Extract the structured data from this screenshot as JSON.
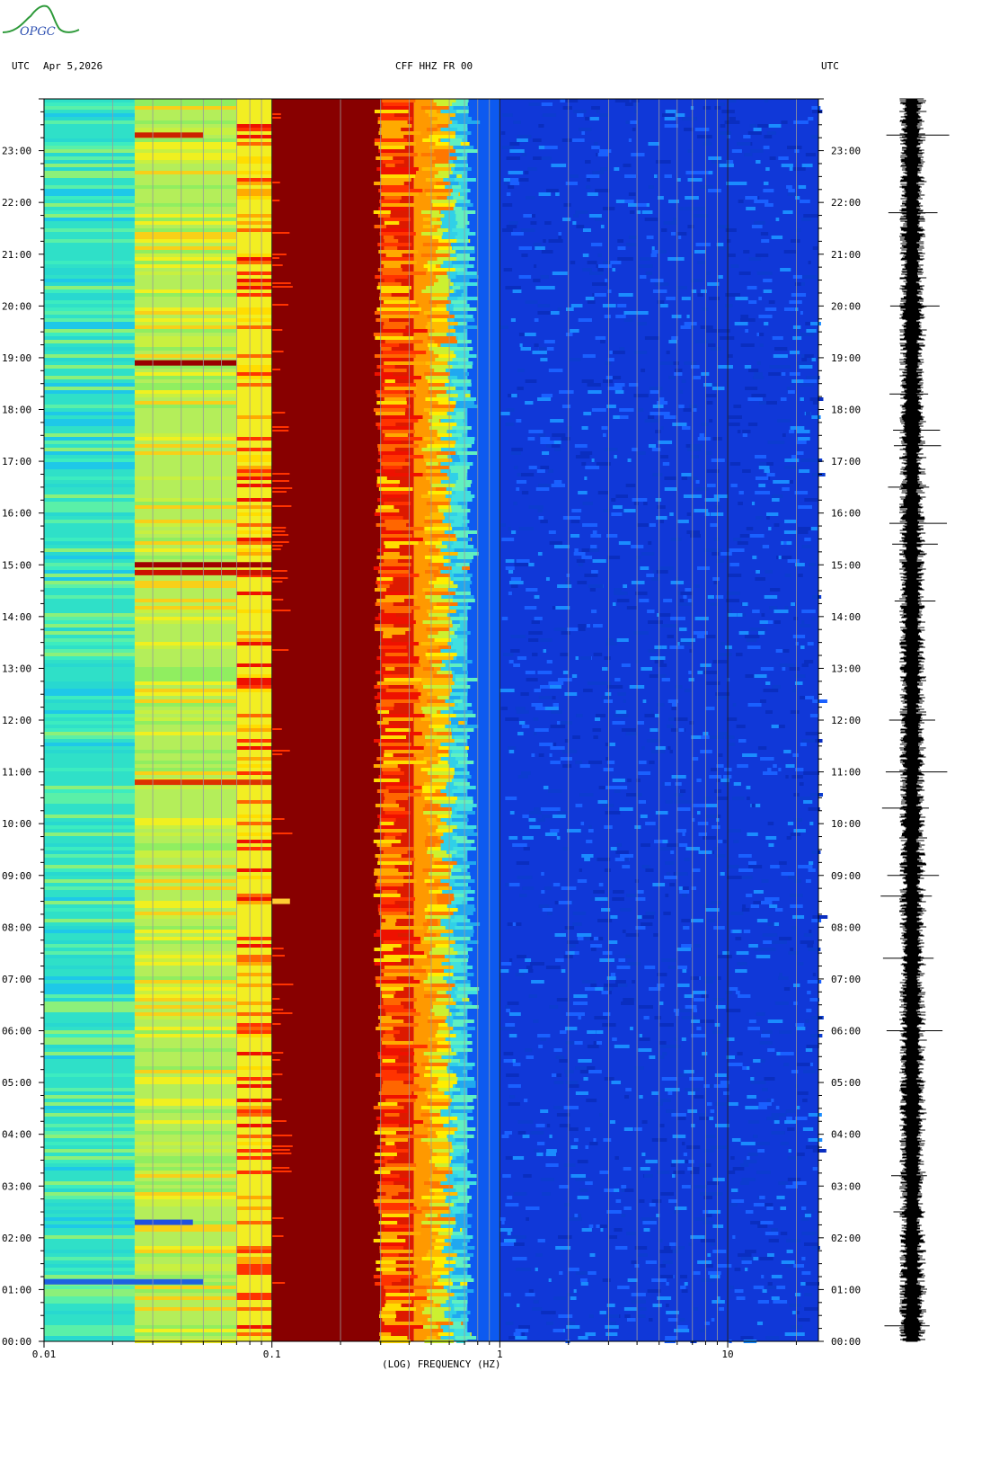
{
  "logo": {
    "text": "OPGC"
  },
  "header": {
    "left_tz": "UTC",
    "date": "Apr 5,2026",
    "station": "CFF HHZ FR 00",
    "right_tz": "UTC"
  },
  "chart_data": {
    "type": "heatmap",
    "title": "CFF HHZ FR 00",
    "date": "Apr 5,2026",
    "xlabel": "(LOG) FREQUENCY (HZ)",
    "xscale": "log",
    "xlim": [
      0.01,
      25
    ],
    "x_ticks": [
      "0.01",
      "0.1",
      "1",
      "10"
    ],
    "y_ticks": [
      "00:00",
      "01:00",
      "02:00",
      "03:00",
      "04:00",
      "05:00",
      "06:00",
      "07:00",
      "08:00",
      "09:00",
      "10:00",
      "11:00",
      "12:00",
      "13:00",
      "14:00",
      "15:00",
      "16:00",
      "17:00",
      "18:00",
      "19:00",
      "20:00",
      "21:00",
      "22:00",
      "23:00"
    ],
    "ylim_hours": [
      0,
      24
    ],
    "color_bands": [
      {
        "f_min": 0.01,
        "f_max": 0.025,
        "color": "#2fe0c8"
      },
      {
        "f_min": 0.025,
        "f_max": 0.07,
        "color": "#b4ee5a"
      },
      {
        "f_min": 0.07,
        "f_max": 0.1,
        "color": "#f2ee22"
      },
      {
        "f_min": 0.1,
        "f_max": 0.3,
        "color": "#880000"
      },
      {
        "f_min": 0.3,
        "f_max": 0.42,
        "color": "#dd1a00"
      },
      {
        "f_min": 0.42,
        "f_max": 0.55,
        "color": "#ff9900"
      },
      {
        "f_min": 0.55,
        "f_max": 0.72,
        "color": "#30d0e8"
      },
      {
        "f_min": 0.72,
        "f_max": 1.0,
        "color": "#0d5af0"
      },
      {
        "f_min": 1.0,
        "f_max": 25,
        "color": "#1038d8"
      }
    ],
    "events": [
      {
        "hour": 23.3,
        "f_min": 0.025,
        "f_max": 0.05,
        "color": "#cc2200"
      },
      {
        "hour": 18.9,
        "f_min": 0.025,
        "f_max": 0.07,
        "color": "#990000"
      },
      {
        "hour": 15.0,
        "f_min": 0.025,
        "f_max": 0.1,
        "color": "#a00000"
      },
      {
        "hour": 14.85,
        "f_min": 0.025,
        "f_max": 0.1,
        "color": "#cc1100"
      },
      {
        "hour": 10.8,
        "f_min": 0.025,
        "f_max": 0.1,
        "color": "#dd3300"
      },
      {
        "hour": 8.5,
        "f_min": 0.1,
        "f_max": 0.12,
        "color": "#ffcc33"
      },
      {
        "hour": 2.3,
        "f_min": 0.025,
        "f_max": 0.045,
        "color": "#2050e0"
      },
      {
        "hour": 1.15,
        "f_min": 0.01,
        "f_max": 0.05,
        "color": "#1e60e0"
      }
    ],
    "seismogram_spikes_hours": [
      23.3,
      21.8,
      20.0,
      18.3,
      17.6,
      17.3,
      16.5,
      15.8,
      15.4,
      14.3,
      12.0,
      11.0,
      10.3,
      9.0,
      8.6,
      7.4,
      6.0,
      3.2,
      2.5,
      0.3
    ]
  }
}
